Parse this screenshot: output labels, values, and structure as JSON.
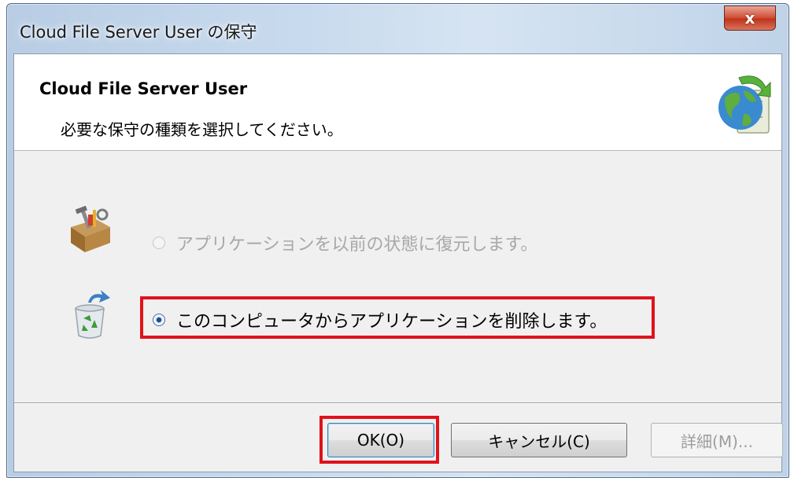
{
  "window": {
    "title": "Cloud File Server User の保守",
    "close_label": "x"
  },
  "header": {
    "title": "Cloud File Server User",
    "subtitle": "必要な保守の種類を選択してください。"
  },
  "options": [
    {
      "label": "アプリケーションを以前の状態に復元します。",
      "enabled": false,
      "selected": false,
      "icon": "toolbox-icon"
    },
    {
      "label": "このコンピュータからアプリケーションを削除します。",
      "enabled": true,
      "selected": true,
      "icon": "recycle-bin-icon"
    }
  ],
  "buttons": {
    "ok_label": "OK(O)",
    "cancel_label": "キャンセル(C)",
    "details_label": "詳細(M)..."
  },
  "colors": {
    "highlight": "#e0121b",
    "close_button": "#c0351c"
  }
}
